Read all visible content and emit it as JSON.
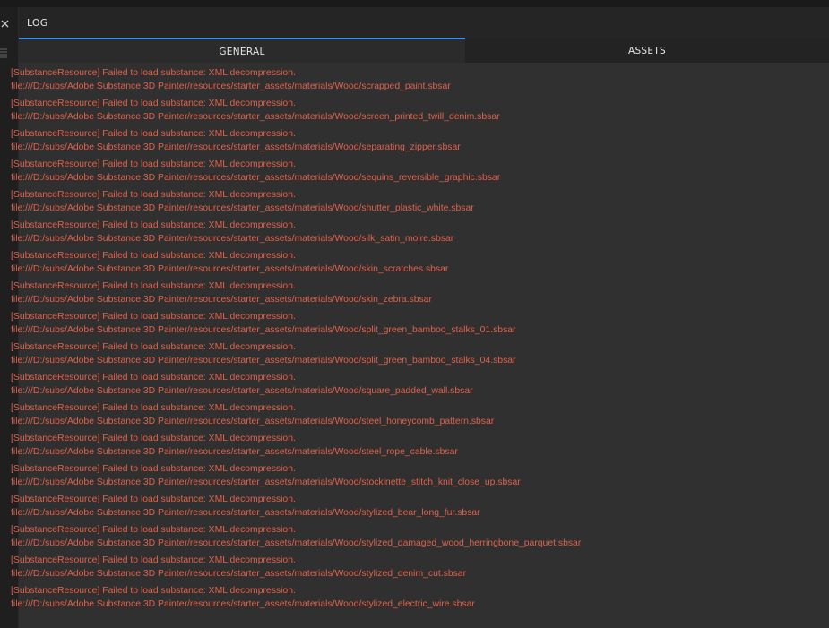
{
  "panel": {
    "title": "LOG",
    "tabs": [
      {
        "label": "GENERAL",
        "active": true
      },
      {
        "label": "ASSETS",
        "active": false
      }
    ]
  },
  "colors": {
    "accent": "#3b8ff0",
    "error_text": "#e0614c"
  },
  "icons": {
    "close": "close-icon",
    "menu": "menu-icon"
  },
  "log": {
    "entries": [
      {
        "message": "[SubstanceResource] Failed to load substance: XML decompression.",
        "path": "file:///D:/subs/Adobe Substance 3D Painter/resources/starter_assets/materials/Wood/scrapped_paint.sbsar"
      },
      {
        "message": "[SubstanceResource] Failed to load substance: XML decompression.",
        "path": "file:///D:/subs/Adobe Substance 3D Painter/resources/starter_assets/materials/Wood/screen_printed_twill_denim.sbsar"
      },
      {
        "message": "[SubstanceResource] Failed to load substance: XML decompression.",
        "path": "file:///D:/subs/Adobe Substance 3D Painter/resources/starter_assets/materials/Wood/separating_zipper.sbsar"
      },
      {
        "message": "[SubstanceResource] Failed to load substance: XML decompression.",
        "path": "file:///D:/subs/Adobe Substance 3D Painter/resources/starter_assets/materials/Wood/sequins_reversible_graphic.sbsar"
      },
      {
        "message": "[SubstanceResource] Failed to load substance: XML decompression.",
        "path": "file:///D:/subs/Adobe Substance 3D Painter/resources/starter_assets/materials/Wood/shutter_plastic_white.sbsar"
      },
      {
        "message": "[SubstanceResource] Failed to load substance: XML decompression.",
        "path": "file:///D:/subs/Adobe Substance 3D Painter/resources/starter_assets/materials/Wood/silk_satin_moire.sbsar"
      },
      {
        "message": "[SubstanceResource] Failed to load substance: XML decompression.",
        "path": "file:///D:/subs/Adobe Substance 3D Painter/resources/starter_assets/materials/Wood/skin_scratches.sbsar"
      },
      {
        "message": "[SubstanceResource] Failed to load substance: XML decompression.",
        "path": "file:///D:/subs/Adobe Substance 3D Painter/resources/starter_assets/materials/Wood/skin_zebra.sbsar"
      },
      {
        "message": "[SubstanceResource] Failed to load substance: XML decompression.",
        "path": "file:///D:/subs/Adobe Substance 3D Painter/resources/starter_assets/materials/Wood/split_green_bamboo_stalks_01.sbsar"
      },
      {
        "message": "[SubstanceResource] Failed to load substance: XML decompression.",
        "path": "file:///D:/subs/Adobe Substance 3D Painter/resources/starter_assets/materials/Wood/split_green_bamboo_stalks_04.sbsar"
      },
      {
        "message": "[SubstanceResource] Failed to load substance: XML decompression.",
        "path": "file:///D:/subs/Adobe Substance 3D Painter/resources/starter_assets/materials/Wood/square_padded_wall.sbsar"
      },
      {
        "message": "[SubstanceResource] Failed to load substance: XML decompression.",
        "path": "file:///D:/subs/Adobe Substance 3D Painter/resources/starter_assets/materials/Wood/steel_honeycomb_pattern.sbsar"
      },
      {
        "message": "[SubstanceResource] Failed to load substance: XML decompression.",
        "path": "file:///D:/subs/Adobe Substance 3D Painter/resources/starter_assets/materials/Wood/steel_rope_cable.sbsar"
      },
      {
        "message": "[SubstanceResource] Failed to load substance: XML decompression.",
        "path": "file:///D:/subs/Adobe Substance 3D Painter/resources/starter_assets/materials/Wood/stockinette_stitch_knit_close_up.sbsar"
      },
      {
        "message": "[SubstanceResource] Failed to load substance: XML decompression.",
        "path": "file:///D:/subs/Adobe Substance 3D Painter/resources/starter_assets/materials/Wood/stylized_bear_long_fur.sbsar"
      },
      {
        "message": "[SubstanceResource] Failed to load substance: XML decompression.",
        "path": "file:///D:/subs/Adobe Substance 3D Painter/resources/starter_assets/materials/Wood/stylized_damaged_wood_herringbone_parquet.sbsar"
      },
      {
        "message": "[SubstanceResource] Failed to load substance: XML decompression.",
        "path": "file:///D:/subs/Adobe Substance 3D Painter/resources/starter_assets/materials/Wood/stylized_denim_cut.sbsar"
      },
      {
        "message": "[SubstanceResource] Failed to load substance: XML decompression.",
        "path": "file:///D:/subs/Adobe Substance 3D Painter/resources/starter_assets/materials/Wood/stylized_electric_wire.sbsar"
      }
    ]
  }
}
